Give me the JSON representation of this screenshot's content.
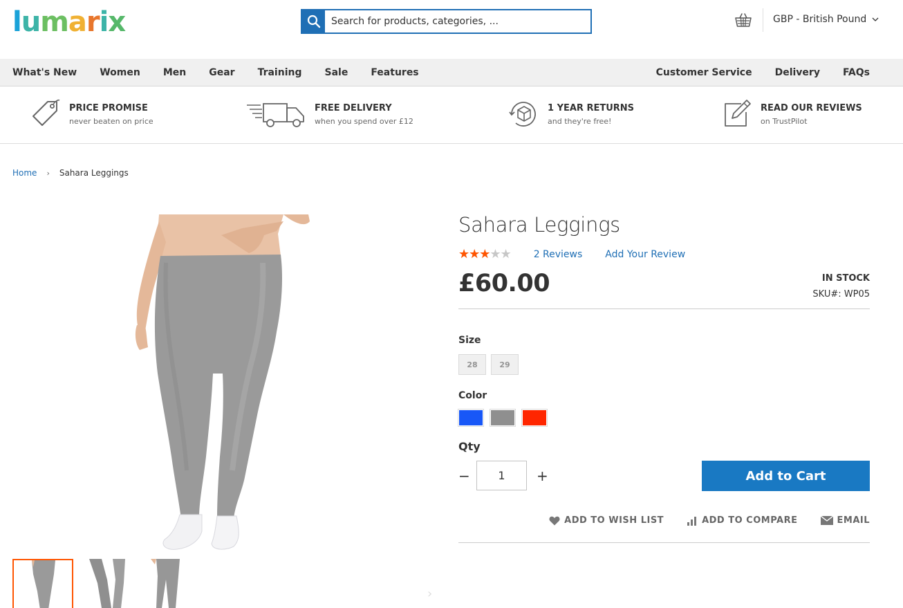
{
  "header": {
    "logo": {
      "text": "lumarix",
      "letters": [
        "l",
        "u",
        "m",
        "a",
        "r",
        "i",
        "x"
      ],
      "colors": [
        "#1aa2d8",
        "#3db4a8",
        "#6cbf62",
        "#f0b133",
        "#e8762c",
        "#3db4a8",
        "#56b86a"
      ]
    },
    "search_placeholder": "Search for products, categories, ...",
    "currency": "GBP - British Pound"
  },
  "nav": {
    "left": [
      "What's New",
      "Women",
      "Men",
      "Gear",
      "Training",
      "Sale",
      "Features"
    ],
    "right": [
      "Customer Service",
      "Delivery",
      "FAQs"
    ]
  },
  "usp": [
    {
      "title": "PRICE PROMISE",
      "sub": "never beaten on price",
      "icon": "price-tag-icon"
    },
    {
      "title": "FREE DELIVERY",
      "sub": "when you spend over £12",
      "icon": "delivery-truck-icon"
    },
    {
      "title": "1 YEAR RETURNS",
      "sub": "and they're free!",
      "icon": "returns-box-icon"
    },
    {
      "title": "READ OUR REVIEWS",
      "sub": "on TrustPilot",
      "icon": "pencil-review-icon"
    }
  ],
  "breadcrumb": {
    "home": "Home",
    "current": "Sahara Leggings"
  },
  "product": {
    "name": "Sahara Leggings",
    "rating": 3,
    "rating_max": 5,
    "reviews_link": "2  Reviews",
    "add_review": "Add Your Review",
    "price": "£60.00",
    "stock": "IN STOCK",
    "sku": "SKU#:  WP05",
    "size_label": "Size",
    "sizes": [
      "28",
      "29"
    ],
    "color_label": "Color",
    "colors": [
      "#1857f7",
      "#8f8f8f",
      "#ff2600"
    ],
    "qty_label": "Qty",
    "qty_value": "1",
    "add_to_cart": "Add to Cart",
    "wishlist": "ADD TO WISH LIST",
    "compare": "ADD TO COMPARE",
    "email": "EMAIL"
  },
  "gallery": {
    "thumb_count": 3,
    "active_thumb": 0
  }
}
